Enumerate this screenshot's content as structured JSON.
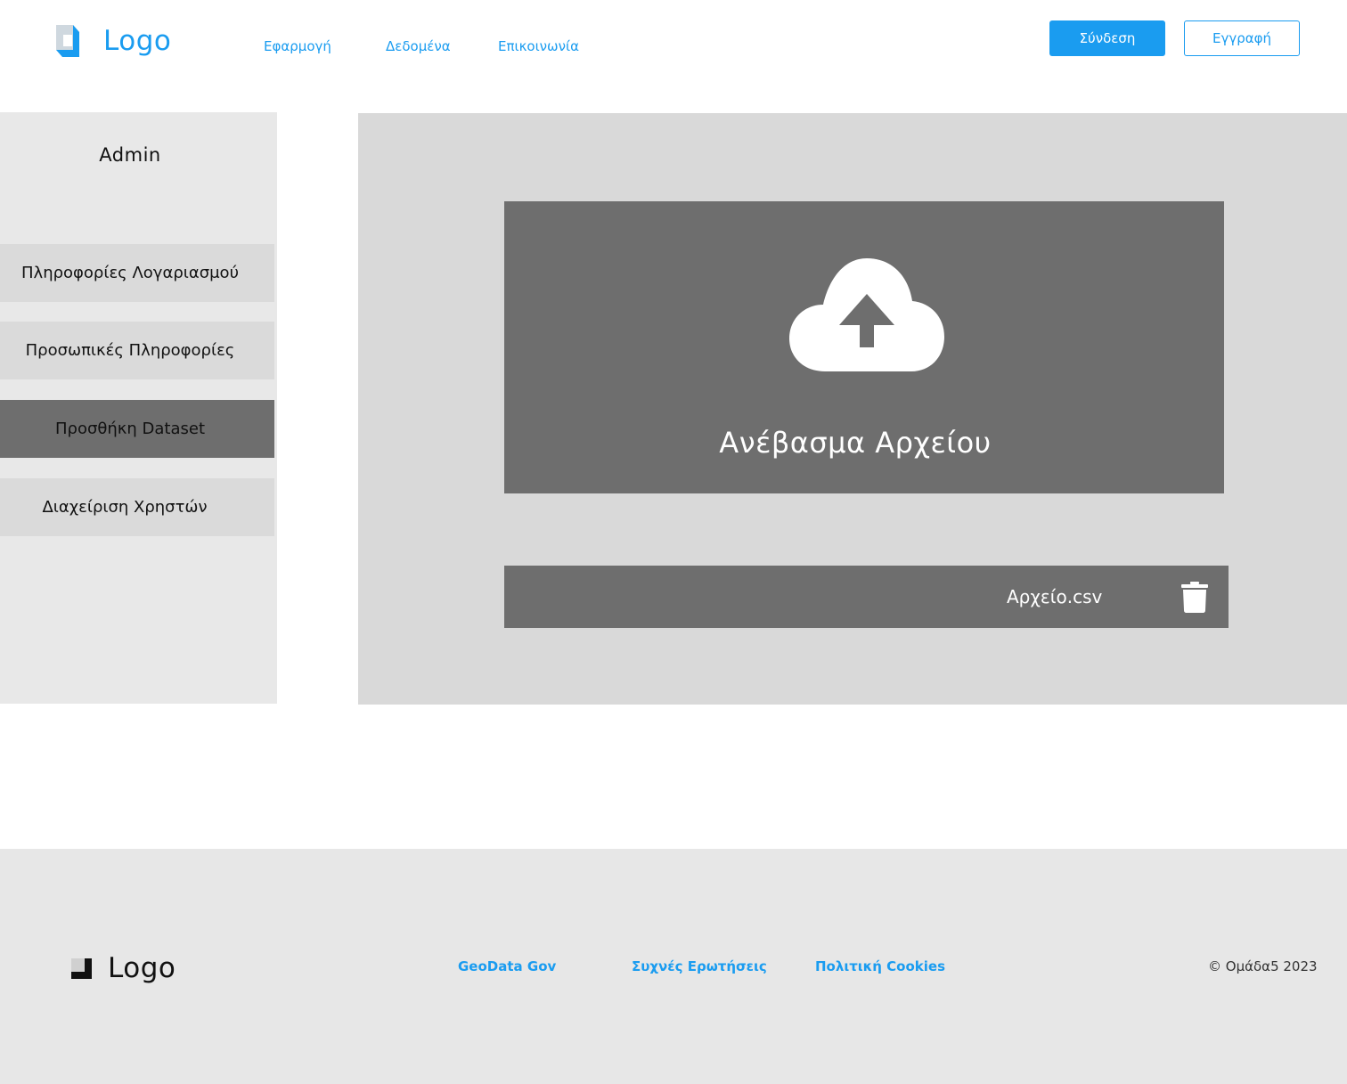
{
  "header": {
    "logo_text": "Logo",
    "nav": [
      {
        "label": "Εφαρμογή"
      },
      {
        "label": "Δεδομένα"
      },
      {
        "label": "Επικοινωνία"
      }
    ],
    "login_label": "Σύνδεση",
    "register_label": "Εγγραφή"
  },
  "sidebar": {
    "title": "Admin",
    "items": [
      {
        "label": "Πληροφορίες Λογαριασμού",
        "active": false
      },
      {
        "label": "Προσωπικές Πληροφορίες",
        "active": false
      },
      {
        "label": "Προσθήκη Dataset",
        "active": true
      },
      {
        "label": "Διαχείριση Χρηστών",
        "active": false
      }
    ]
  },
  "main": {
    "upload_label": "Ανέβασμα Αρχείου",
    "upload_icon": "cloud-upload-icon",
    "file": {
      "name": "Αρχείο.csv",
      "delete_icon": "trash-icon"
    }
  },
  "footer": {
    "logo_text": "Logo",
    "links": [
      {
        "label": "GeoData Gov"
      },
      {
        "label": "Συχνές Ερωτήσεις"
      },
      {
        "label": "Πολιτική Cookies"
      }
    ],
    "copyright": "© Ομάδα5 2023"
  },
  "colors": {
    "accent": "#1a9cf0",
    "sidebar_bg": "#e8e8e8",
    "sidebar_item_bg": "#dadada",
    "active_item_bg": "#6e6e6e",
    "main_bg": "#d9d9d9",
    "panel_bg": "#6e6e6e",
    "footer_bg": "#e7e7e7"
  }
}
